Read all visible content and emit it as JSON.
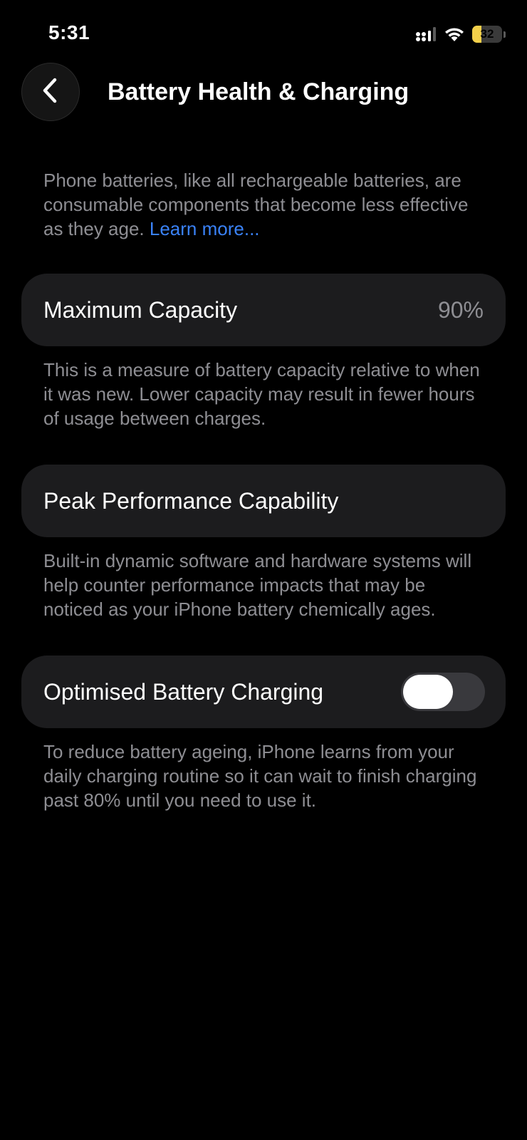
{
  "status_bar": {
    "time": "5:31",
    "battery_level": "32",
    "battery_fraction": 0.32,
    "icons": [
      "cellular-signal-icon",
      "wifi-icon",
      "battery-icon"
    ]
  },
  "nav": {
    "back_icon": "chevron-left-icon",
    "title": "Battery Health & Charging"
  },
  "intro": {
    "text": "Phone batteries, like all rechargeable batteries, are consumable components that become less effective as they age. ",
    "link": "Learn more..."
  },
  "maximum_capacity": {
    "label": "Maximum Capacity",
    "value": "90%",
    "note": "This is a measure of battery capacity relative to when it was new. Lower capacity may result in fewer hours of usage between charges."
  },
  "peak_performance": {
    "label": "Peak Performance Capability",
    "note": "Built-in dynamic software and hardware systems will help counter performance impacts that may be noticed as your iPhone battery chemically ages."
  },
  "optimised_charging": {
    "label": "Optimised Battery Charging",
    "enabled": false,
    "note": "To reduce battery ageing, iPhone learns from your daily charging routine so it can wait to finish charging past 80% until you need to use it."
  },
  "colors": {
    "background": "#000000",
    "card": "#1c1c1e",
    "secondary_text": "#8e8e93",
    "link": "#3a82f7",
    "battery_fill": "#f2cf4a",
    "toggle_off_track": "#39393d"
  }
}
